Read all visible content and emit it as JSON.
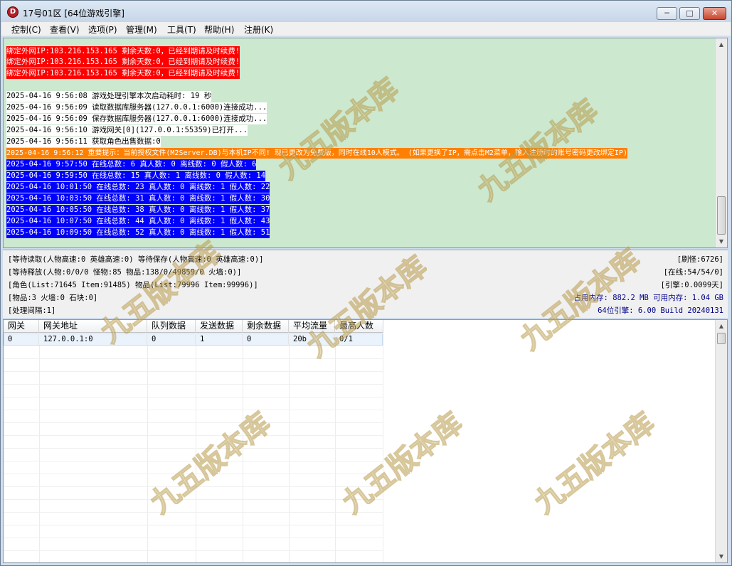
{
  "window": {
    "title": "17号01区 [64位游戏引擎]",
    "icon_letter": "D",
    "buttons": {
      "minimize": "─",
      "maximize": "□",
      "close": "✕"
    }
  },
  "menu": [
    "控制(C)",
    "查看(V)",
    "选项(P)",
    "管理(M)",
    "工具(T)",
    "帮助(H)",
    "注册(K)"
  ],
  "log": [
    {
      "text": "绑定外网IP:103.216.153.165 剩余天数:0，已经到期请及时续费!",
      "style": "red"
    },
    {
      "text": "绑定外网IP:103.216.153.165 剩余天数:0，已经到期请及时续费!",
      "style": "red"
    },
    {
      "text": "绑定外网IP:103.216.153.165 剩余天数:0，已经到期请及时续费!",
      "style": "red"
    },
    {
      "text": "2025-04-16 9:56:08 游戏处理引擎本次启动耗时: 19 秒",
      "style": "normal"
    },
    {
      "text": "2025-04-16 9:56:09 读取数据库服务器(127.0.0.1:6000)连接成功...",
      "style": "normal"
    },
    {
      "text": "2025-04-16 9:56:09 保存数据库服务器(127.0.0.1:6000)连接成功...",
      "style": "normal"
    },
    {
      "text": "2025-04-16 9:56:10 游戏网关[0](127.0.0.1:55359)已打开...",
      "style": "normal"
    },
    {
      "text": "2025-04-16 9:56:11 获取角色出售数据:0",
      "style": "normal"
    },
    {
      "text": "2025-04-16 9:56:12 重要提示：当前授权文件(M2Server.DB)与本机IP不同! 现已更改为免费版，同时在线10人模式。 (如果更换了IP，需点击M2菜单，输入注册时的账号密码更改绑定IP)",
      "style": "orange"
    },
    {
      "text": "2025-04-16 9:57:50 在线总数: 6 真人数: 0 离线数: 0 假人数: 6",
      "style": "blue"
    },
    {
      "text": "2025-04-16 9:59:50 在线总数: 15 真人数: 1 离线数: 0 假人数: 14",
      "style": "blue"
    },
    {
      "text": "2025-04-16 10:01:50 在线总数: 23 真人数: 0 离线数: 1 假人数: 22",
      "style": "blue"
    },
    {
      "text": "2025-04-16 10:03:50 在线总数: 31 真人数: 0 离线数: 1 假人数: 30",
      "style": "blue"
    },
    {
      "text": "2025-04-16 10:05:50 在线总数: 38 真人数: 0 离线数: 1 假人数: 37",
      "style": "blue"
    },
    {
      "text": "2025-04-16 10:07:50 在线总数: 44 真人数: 0 离线数: 1 假人数: 43",
      "style": "blue"
    },
    {
      "text": "2025-04-16 10:09:50 在线总数: 52 真人数: 0 离线数: 1 假人数: 51",
      "style": "blue"
    }
  ],
  "status": {
    "left": [
      "[等待读取(人物高速:0 英雄高速:0) 等待保存(人物高速:0 英雄高速:0)]",
      "[等待释放(人物:0/0/0 怪物:85 物品:138/0/49859/0 火墙:0)]",
      "[角色(List:71645 Item:91485) 物品(List:79996 Item:99996)]",
      "[物品:3 火墙:0 石块:0]",
      "[处理间隔:1]"
    ],
    "refresh": "[刷怪:6726]",
    "online": "[在线:54/54/0]",
    "engine_days": "[引擎:0.0099天]",
    "memory": "占用内存: 882.2 MB 可用内存: 1.04 GB",
    "build": "64位引擎: 6.00 Build 20240131"
  },
  "gateway_table": {
    "headers": [
      "网关",
      "网关地址",
      "队列数据",
      "发送数据",
      "剩余数据",
      "平均流量",
      "最高人数"
    ],
    "rows": [
      [
        "0",
        "127.0.0.1:0",
        "0",
        "1",
        "0",
        "20b",
        "0/1"
      ]
    ]
  },
  "watermark": {
    "text": "九五版本库",
    "url": "www.95bbk.com"
  }
}
